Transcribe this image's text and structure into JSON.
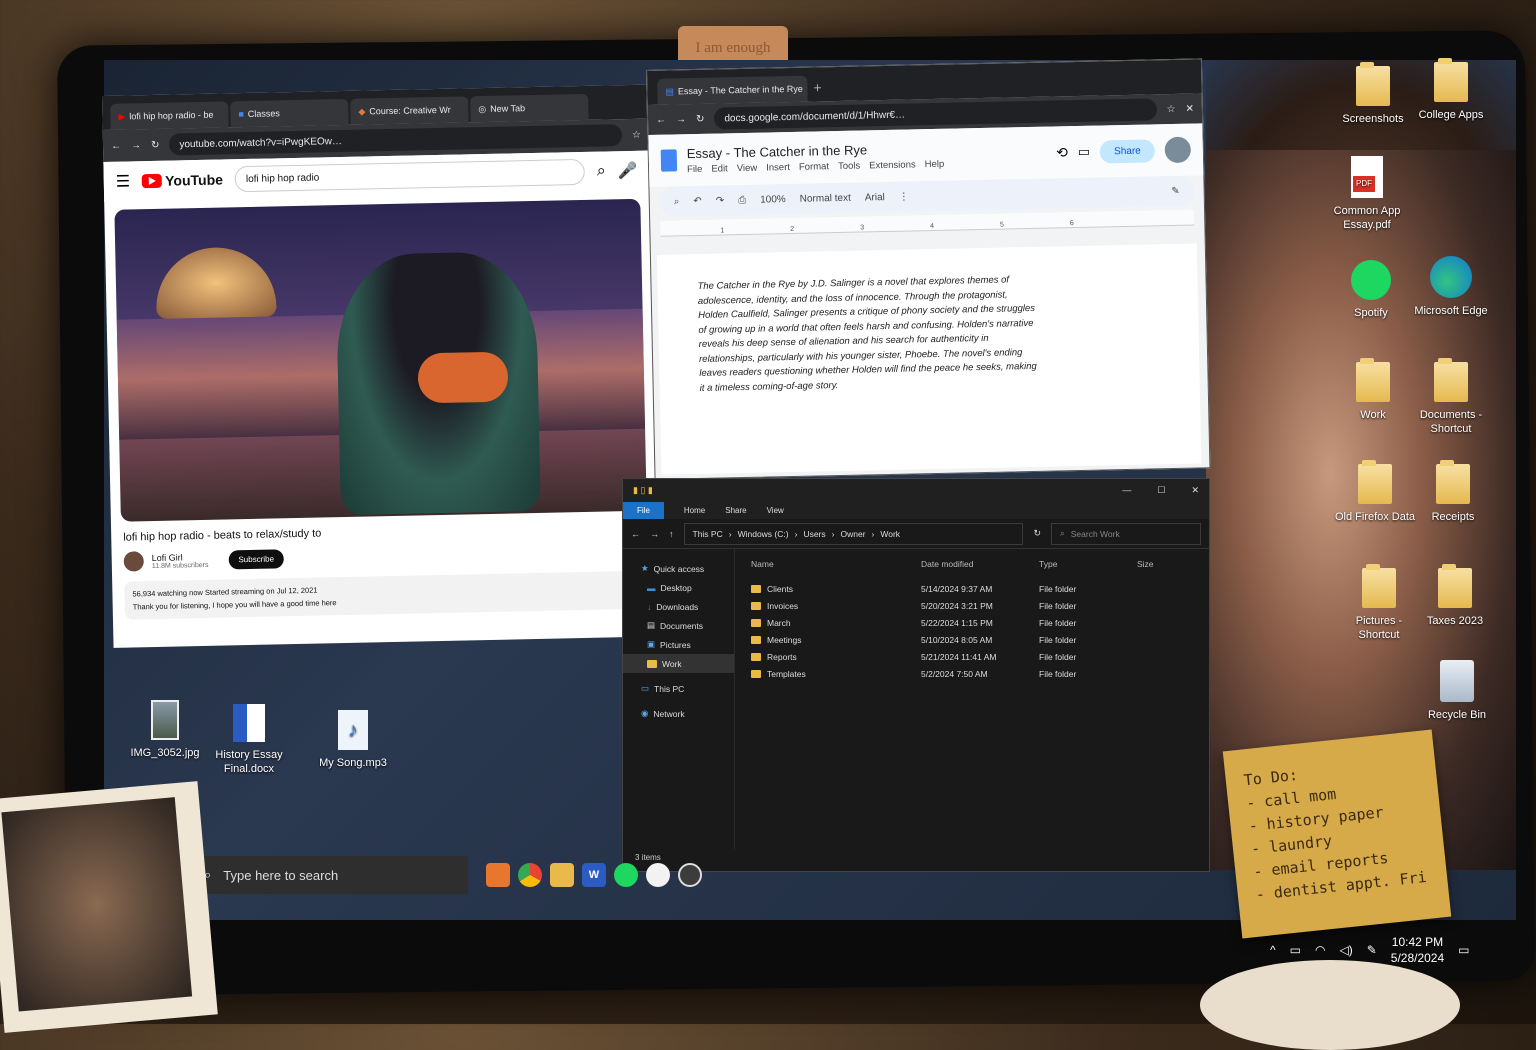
{
  "sticker": "I am enough",
  "chrome": {
    "tabs": [
      "lofi hip hop radio - be",
      "Classes",
      "Course: Creative Wr",
      "New Tab"
    ],
    "url": "youtube.com/watch?v=iPwgKEOw…"
  },
  "youtube": {
    "logo": "YouTube",
    "search_value": "lofi hip hop radio",
    "video_title": "lofi hip hop radio - beats to relax/study to",
    "channel": "Lofi Girl",
    "subscribers": "11.8M subscribers",
    "subscribe_label": "Subscribe",
    "desc_line1": "56,934 watching now  Started streaming on Jul 12, 2021",
    "desc_line2": "Thank you for listening, I hope you will have a good time here"
  },
  "docs": {
    "tab": "Essay - The Catcher in the Rye",
    "url": "docs.google.com/document/d/1/Hhwr€…",
    "title": "Essay - The Catcher in the Rye",
    "menu": [
      "File",
      "Edit",
      "View",
      "Insert",
      "Format",
      "Tools",
      "Extensions",
      "Help"
    ],
    "share_label": "Share",
    "zoom": "100%",
    "style": "Normal text",
    "font": "Arial",
    "ruler": [
      "1",
      "2",
      "3",
      "4",
      "5",
      "6"
    ],
    "body": "The Catcher in the Rye by J.D. Salinger is a novel that explores themes of adolescence, identity, and the loss of innocence. Through the protagonist, Holden Caulfield, Salinger presents a critique of phony society and the struggles of growing up in a world that often feels harsh and confusing. Holden's narrative reveals his deep sense of alienation and his search for authenticity in relationships, particularly with his younger sister, Phoebe. The novel's ending leaves readers questioning whether Holden will find the peace he seeks, making it a timeless coming-of-age story."
  },
  "explorer": {
    "ribbon": [
      "File",
      "Home",
      "Share",
      "View"
    ],
    "breadcrumb": [
      "This PC",
      "Windows (C:)",
      "Users",
      "Owner",
      "Work"
    ],
    "search_placeholder": "Search Work",
    "columns": [
      "Name",
      "Date modified",
      "Type",
      "Size"
    ],
    "nav": [
      "Quick access",
      "Desktop",
      "Downloads",
      "Documents",
      "Pictures",
      "Work",
      "This PC",
      "Network"
    ],
    "rows": [
      {
        "name": "Clients",
        "date": "5/14/2024 9:37 AM",
        "type": "File folder"
      },
      {
        "name": "Invoices",
        "date": "5/20/2024 3:21 PM",
        "type": "File folder"
      },
      {
        "name": "March",
        "date": "5/22/2024 1:15 PM",
        "type": "File folder"
      },
      {
        "name": "Meetings",
        "date": "5/10/2024 8:05 AM",
        "type": "File folder"
      },
      {
        "name": "Reports",
        "date": "5/21/2024 11:41 AM",
        "type": "File folder"
      },
      {
        "name": "Templates",
        "date": "5/2/2024 7:50 AM",
        "type": "File folder"
      }
    ],
    "status": "3 items"
  },
  "desktop_left": [
    "IMG_3052.jpg",
    "History Essay Final.docx",
    "My Song.mp3"
  ],
  "desktop_right": [
    "Screenshots",
    "College Apps",
    "Common App Essay.pdf",
    "Spotify",
    "Microsoft Edge",
    "Work",
    "Documents - Shortcut",
    "Old Firefox Data",
    "Receipts",
    "Pictures - Shortcut",
    "Taxes 2023",
    "Recycle Bin"
  ],
  "taskbar": {
    "search_placeholder": "Type here to search"
  },
  "tray": {
    "time": "10:42 PM",
    "date": "5/28/2024"
  },
  "sticky": [
    "To Do:",
    "- call mom",
    "- history paper",
    "- laundry",
    "- email reports",
    "- dentist appt. Fri"
  ]
}
